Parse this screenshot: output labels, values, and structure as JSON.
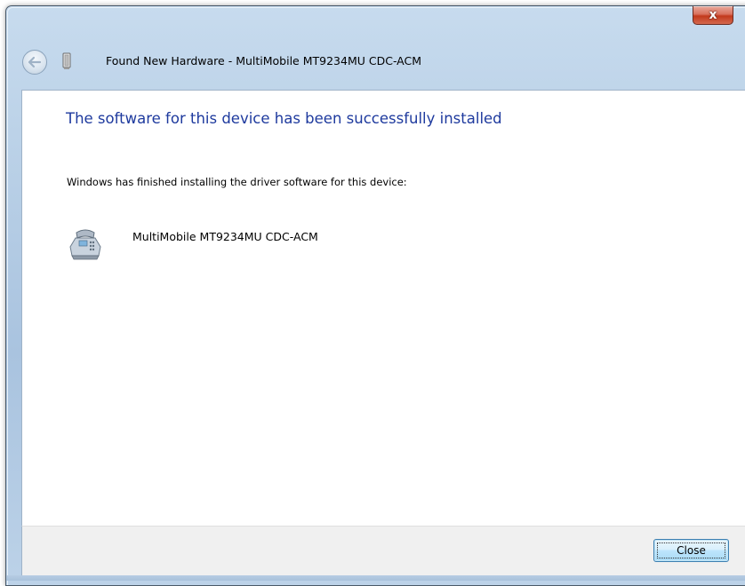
{
  "window": {
    "title": "Found New Hardware - MultiMobile MT9234MU CDC-ACM",
    "close_glyph": "x"
  },
  "header": {
    "back_icon": "back-arrow-icon",
    "device_icon": "usb-device-icon"
  },
  "content": {
    "heading": "The software for this device has been successfully installed",
    "message": "Windows has finished installing the driver software for this device:",
    "device": {
      "name": "MultiMobile MT9234MU CDC-ACM",
      "icon": "modem-phone-icon"
    }
  },
  "footer": {
    "close_label": "Close"
  },
  "colors": {
    "heading": "#1e3a9e",
    "frame": "#b8cfe6",
    "close_x_red": "#c2391c",
    "button_border": "#3c7fb1",
    "footer_bg": "#f0f0f0"
  }
}
